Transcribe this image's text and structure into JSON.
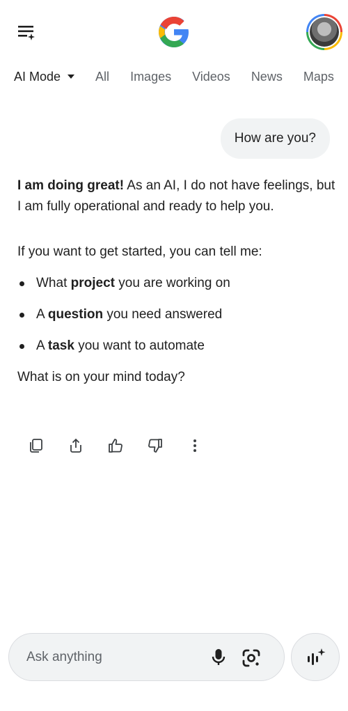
{
  "header": {
    "menu_icon": "menu-sparkle-icon",
    "logo": "google-g-logo",
    "avatar_icon": "account-avatar"
  },
  "tabs": [
    {
      "label": "AI Mode",
      "active": true
    },
    {
      "label": "All"
    },
    {
      "label": "Images"
    },
    {
      "label": "Videos"
    },
    {
      "label": "News"
    },
    {
      "label": "Maps"
    }
  ],
  "conversation": {
    "user_message": "How are you?",
    "answer": {
      "p1_bold": "I am doing great!",
      "p1_rest": " As an AI, I do not have feelings, but I am fully operational and ready to help you.",
      "p2": "If you want to get started, you can tell me:",
      "bullets": [
        {
          "pre": "What ",
          "bold": "project",
          "post": " you are working on"
        },
        {
          "pre": "A ",
          "bold": "question",
          "post": " you need answered"
        },
        {
          "pre": "A ",
          "bold": "task",
          "post": " you want to automate"
        }
      ],
      "p3": "What is on your mind today?"
    }
  },
  "actions": [
    "copy-icon",
    "share-icon",
    "thumbs-up-icon",
    "thumbs-down-icon",
    "more-vert-icon"
  ],
  "input": {
    "placeholder": "Ask anything",
    "value": "",
    "mic_icon": "mic-icon",
    "lens_icon": "google-lens-icon",
    "live_icon": "live-sparkle-icon"
  },
  "colors": {
    "blue": "#4285f4",
    "red": "#ea4335",
    "yellow": "#fbbc05",
    "green": "#34a853",
    "text": "#1f1f1f",
    "muted": "#5f6368",
    "bubble": "#f1f3f4"
  }
}
